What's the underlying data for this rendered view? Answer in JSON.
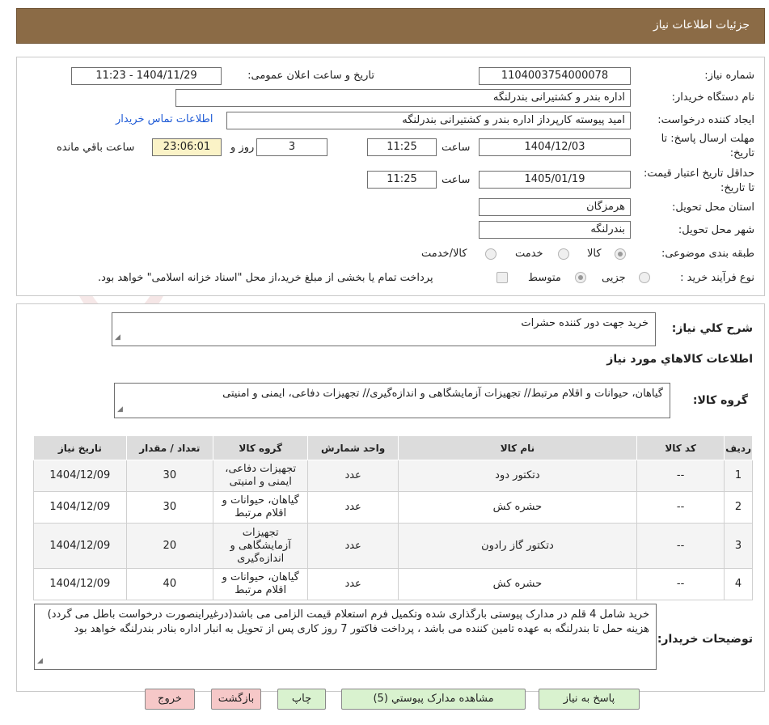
{
  "header": {
    "title": "جزئیات اطلاعات نیاز"
  },
  "need_info": {
    "need_number_label": "شماره نیاز:",
    "need_number": "1104003754000078",
    "announce_label": "تاریخ و ساعت اعلان عمومی:",
    "announce_value": "1404/11/29 - 11:23",
    "buyer_org_label": "نام دستگاه خریدار:",
    "buyer_org": "اداره بندر و کشتیرانی بندرلنگه",
    "requester_label": "ایجاد کننده درخواست:",
    "requester": "امید پیوسته کارپرداز اداره بندر و کشتیرانی بندرلنگه",
    "contact_link": "اطلاعات تماس خریدار",
    "send_deadline_label": "مهلت ارسال پاسخ: تا تاریخ:",
    "send_deadline_date": "1404/12/03",
    "time_word": "ساعت",
    "send_deadline_time": "11:25",
    "days_count": "3",
    "days_word": "روز و",
    "remaining_time": "23:06:01",
    "remaining_label": "ساعت باقي مانده",
    "price_validity_label": "حداقل تاریخ اعتبار قیمت: تا تاریخ:",
    "price_validity_date": "1405/01/19",
    "price_validity_time": "11:25",
    "province_label": "استان محل تحویل:",
    "province": "هرمزگان",
    "city_label": "شهر محل تحویل:",
    "city": "بندرلنگه",
    "category_label": "طبقه بندی موضوعی:",
    "category_options": [
      "کالا",
      "خدمت",
      "کالا/خدمت"
    ],
    "process_label": "نوع فرآیند خرید :",
    "process_options": [
      "جزیی",
      "متوسط"
    ],
    "payment_note": "پرداخت تمام یا بخشی از مبلغ خرید،از محل \"اسناد خزانه اسلامی\" خواهد بود."
  },
  "description": {
    "label": "شرح کلي نياز:",
    "text": "خرید جهت دور کننده حشرات"
  },
  "goods": {
    "title": "اطلاعات کالاهاي مورد نياز",
    "group_label": "گروه کالا:",
    "group_text": "گیاهان، حیوانات و اقلام مرتبط// تجهیزات آزمایشگاهی و اندازه‌گیری// تجهیزات دفاعی، ایمنی و امنیتی",
    "columns": [
      "ردیف",
      "کد کالا",
      "نام کالا",
      "واحد شمارش",
      "گروه کالا",
      "تعداد / مقدار",
      "تاریخ نیاز"
    ],
    "rows": [
      [
        "1",
        "--",
        "دتکتور دود",
        "عدد",
        "تجهیزات دفاعی، ایمنی و امنیتی",
        "30",
        "1404/12/09"
      ],
      [
        "2",
        "--",
        "حشره کش",
        "عدد",
        "گیاهان، حیوانات و اقلام مرتبط",
        "30",
        "1404/12/09"
      ],
      [
        "3",
        "--",
        "دتکتور گاز رادون",
        "عدد",
        "تجهیزات آزمایشگاهی و اندازه‌گیری",
        "20",
        "1404/12/09"
      ],
      [
        "4",
        "--",
        "حشره کش",
        "عدد",
        "گیاهان، حیوانات و اقلام مرتبط",
        "40",
        "1404/12/09"
      ]
    ]
  },
  "buyer_notes": {
    "label": "توضیحات خریدار:",
    "text": "خرید شامل 4 قلم در مدارک پیوستی بارگذاری شده وتکمیل فرم استعلام قیمت الزامی می باشد(درغیراینصورت درخواست باطل می گردد) هزینه حمل تا بندرلنگه به عهده تامین کننده می باشد ، پرداخت فاکتور 7 روز کاری پس از تحویل به انبار اداره بنادر بندرلنگه خواهد بود"
  },
  "buttons": {
    "reply": "پاسخ به نیاز",
    "attachments": "مشاهده مدارک پیوستي (5)",
    "print": "چاپ",
    "back": "بازگشت",
    "exit": "خروج"
  },
  "watermark": {
    "text": "AriaTender.neT"
  },
  "colors": {
    "header_bg": "#8b6b46",
    "green_button": "#d9f2cf",
    "pink_button": "#f6c8c8",
    "link": "#1f5bd6",
    "countdown_bg": "#fbf3c7"
  }
}
